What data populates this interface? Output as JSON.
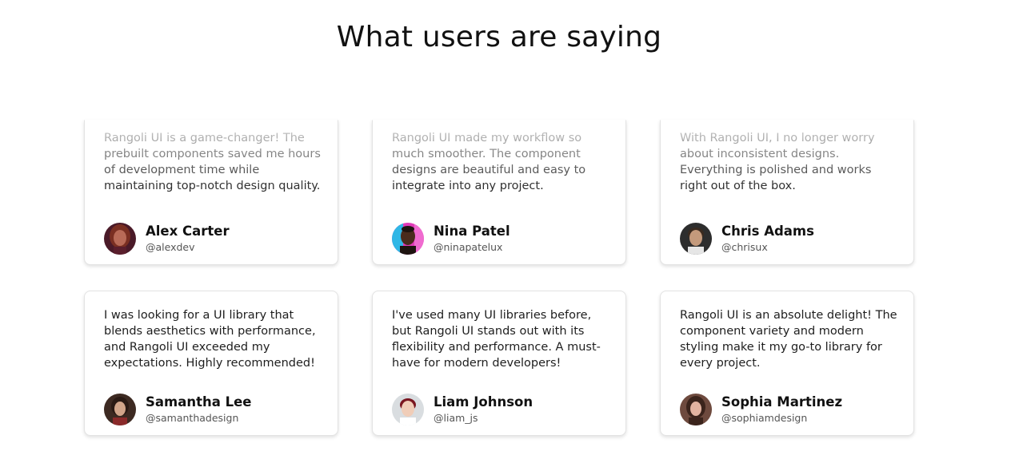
{
  "section": {
    "title": "What users are saying"
  },
  "testimonials": [
    {
      "quote": "Rangoli UI is a game-changer! The prebuilt components saved me hours of development time while maintaining top-notch design quality.",
      "name": "Alex Carter",
      "handle": "@alexdev",
      "avatar_colors": {
        "bg": "#5a1e2c",
        "face": "#b86a57",
        "hair": "#7a2f22"
      }
    },
    {
      "quote": "Rangoli UI made my workflow so much smoother. The component designs are beautiful and easy to integrate into any project.",
      "name": "Nina Patel",
      "handle": "@ninapatelux",
      "avatar_colors": {
        "bg": "#e03bb8",
        "face": "#4a2b1d",
        "hair": "#1e1410"
      }
    },
    {
      "quote": "With Rangoli UI, I no longer worry about inconsistent designs. Everything is polished and works right out of the box.",
      "name": "Chris Adams",
      "handle": "@chrisux",
      "avatar_colors": {
        "bg": "#2d2d2d",
        "face": "#c49a7c",
        "hair": "#3a2a1f"
      }
    },
    {
      "quote": "I was looking for a UI library that blends aesthetics with performance, and Rangoli UI exceeded my expectations. Highly recommended!",
      "name": "Samantha Lee",
      "handle": "@samanthadesign",
      "avatar_colors": {
        "bg": "#3d2a22",
        "face": "#d1a58a",
        "hair": "#2a1a14"
      }
    },
    {
      "quote": "I've used many UI libraries before, but Rangoli UI stands out with its flexibility and performance. A must-have for modern developers!",
      "name": "Liam Johnson",
      "handle": "@liam_js",
      "avatar_colors": {
        "bg": "#d9dde0",
        "face": "#f0cdb8",
        "hair": "#7a1620"
      }
    },
    {
      "quote": "Rangoli UI is an absolute delight! The component variety and modern styling make it my go-to library for every project.",
      "name": "Sophia Martinez",
      "handle": "@sophiamdesign",
      "avatar_colors": {
        "bg": "#6e4a3e",
        "face": "#e2b3a0",
        "hair": "#3b241c"
      }
    }
  ]
}
